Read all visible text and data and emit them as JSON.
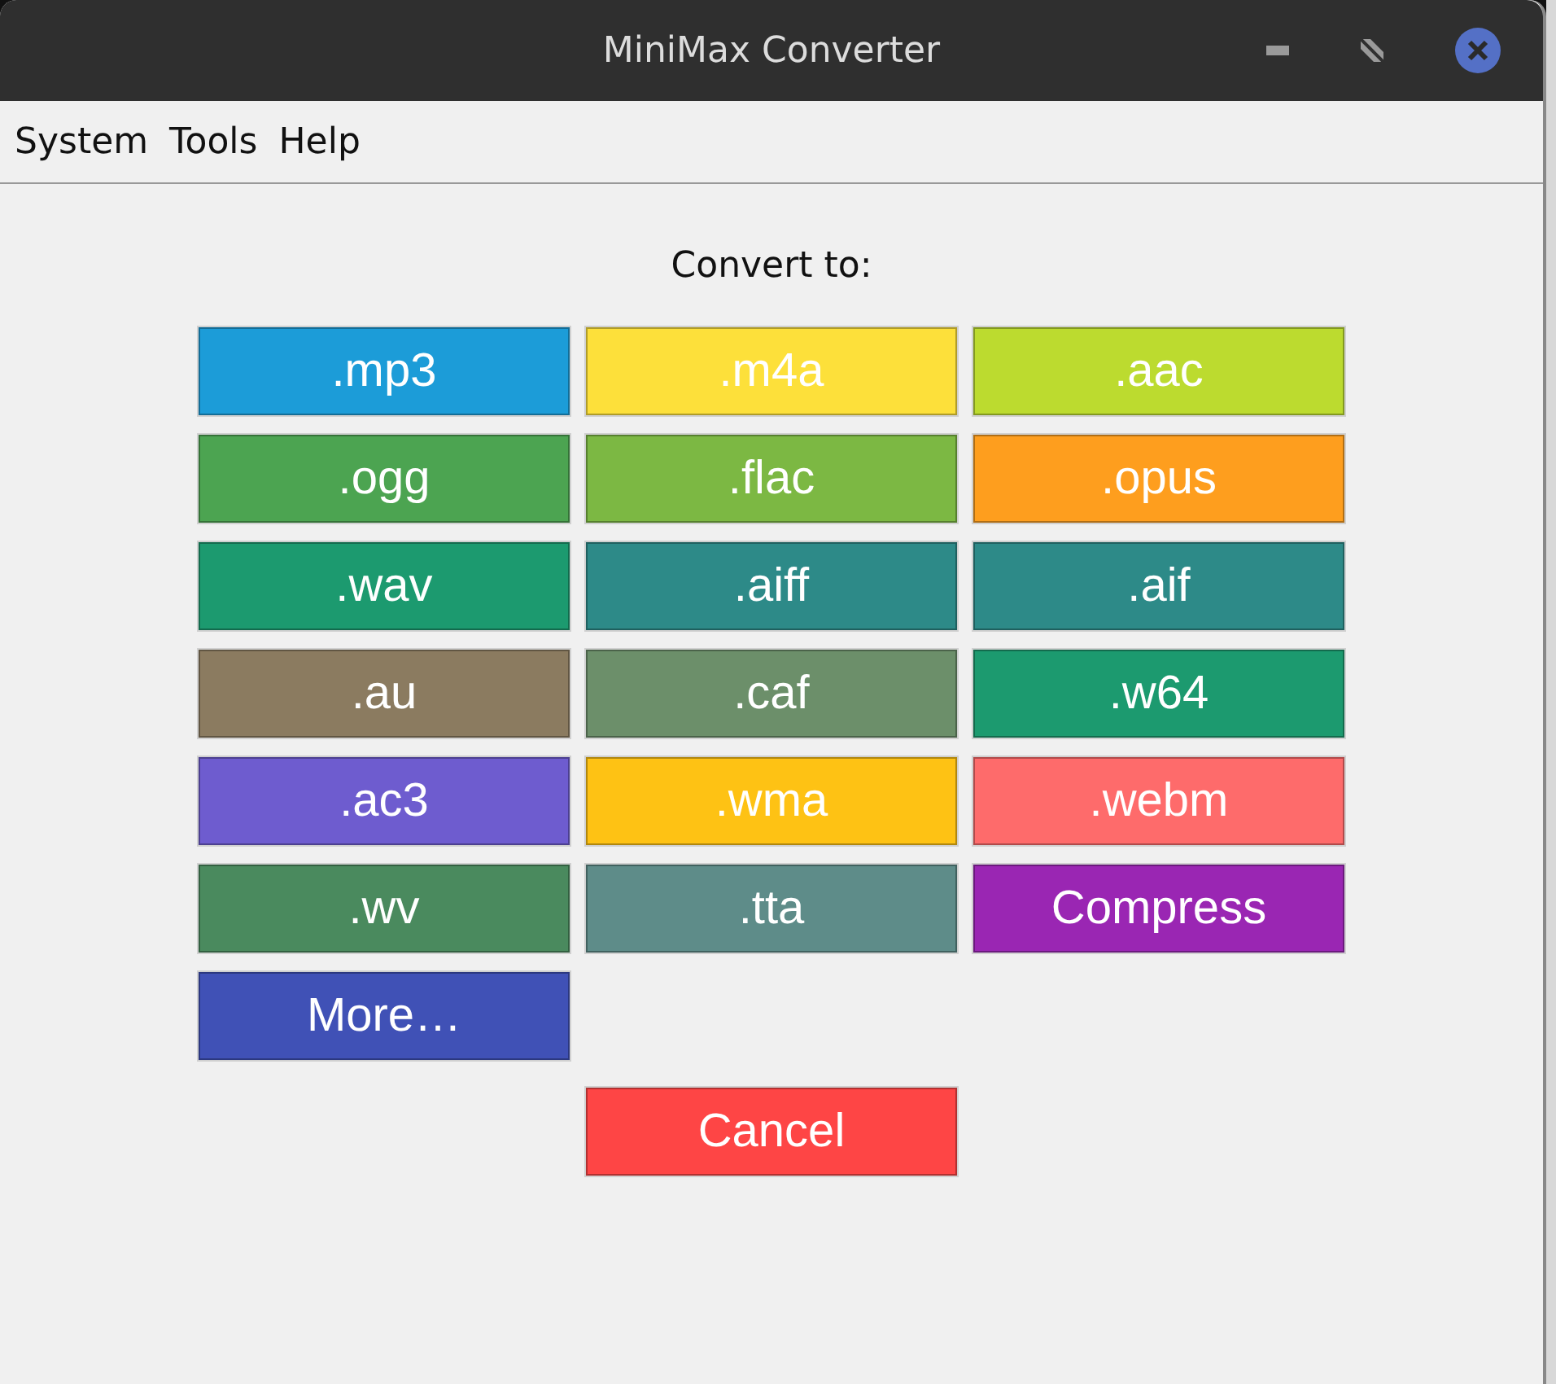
{
  "window": {
    "title": "MiniMax Converter"
  },
  "menu": [
    "System",
    "Tools",
    "Help"
  ],
  "heading": "Convert to:",
  "formats": [
    {
      "label": ".mp3",
      "color": "#1c9cd8"
    },
    {
      "label": ".m4a",
      "color": "#fde03a"
    },
    {
      "label": ".aac",
      "color": "#bcdb2f"
    },
    {
      "label": ".ogg",
      "color": "#4ca451"
    },
    {
      "label": ".flac",
      "color": "#7cb843"
    },
    {
      "label": ".opus",
      "color": "#fe9e1e"
    },
    {
      "label": ".wav",
      "color": "#1c9a6f"
    },
    {
      "label": ".aiff",
      "color": "#2d8a88"
    },
    {
      "label": ".aif",
      "color": "#2d8a88"
    },
    {
      "label": ".au",
      "color": "#8b7b60"
    },
    {
      "label": ".caf",
      "color": "#6c8f6a"
    },
    {
      "label": ".w64",
      "color": "#1c9a6f"
    },
    {
      "label": ".ac3",
      "color": "#6e5ccf"
    },
    {
      "label": ".wma",
      "color": "#fec214"
    },
    {
      "label": ".webm",
      "color": "#fe6b6b"
    },
    {
      "label": ".wv",
      "color": "#4a8a5e"
    },
    {
      "label": ".tta",
      "color": "#5e8c89"
    },
    {
      "label": "Compress",
      "color": "#9a26b3"
    },
    {
      "label": "More…",
      "color": "#4051b6"
    }
  ],
  "cancel": {
    "label": "Cancel",
    "color": "#fe4545"
  }
}
